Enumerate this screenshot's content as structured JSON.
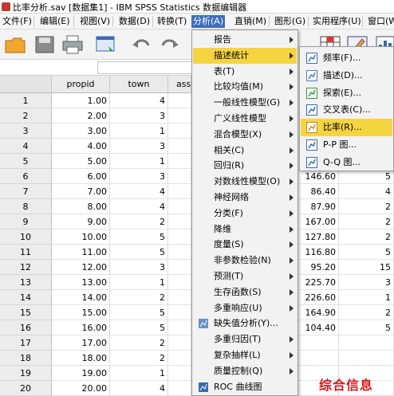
{
  "window": {
    "title": "比率分析.sav [数据集1] - IBM SPSS Statistics 数据编辑器"
  },
  "menubar": [
    {
      "label": "文件(F)"
    },
    {
      "label": "编辑(E)"
    },
    {
      "label": "视图(V)"
    },
    {
      "label": "数据(D)"
    },
    {
      "label": "转换(T)"
    },
    {
      "label": "分析(A)"
    },
    {
      "label": "直销(M)"
    },
    {
      "label": "图形(G)"
    },
    {
      "label": "实用程序(U)"
    },
    {
      "label": "窗口(W)"
    }
  ],
  "columns": [
    "propid",
    "town",
    "ass"
  ],
  "rows": [
    {
      "n": "1",
      "propid": "1.00",
      "town": "4"
    },
    {
      "n": "2",
      "propid": "2.00",
      "town": "3"
    },
    {
      "n": "3",
      "propid": "3.00",
      "town": "1"
    },
    {
      "n": "4",
      "propid": "4.00",
      "town": "3"
    },
    {
      "n": "5",
      "propid": "5.00",
      "town": "1"
    },
    {
      "n": "6",
      "propid": "6.00",
      "town": "3"
    },
    {
      "n": "7",
      "propid": "7.00",
      "town": "4"
    },
    {
      "n": "8",
      "propid": "8.00",
      "town": "4"
    },
    {
      "n": "9",
      "propid": "9.00",
      "town": "2"
    },
    {
      "n": "10",
      "propid": "10.00",
      "town": "5"
    },
    {
      "n": "11",
      "propid": "11.00",
      "town": "5"
    },
    {
      "n": "12",
      "propid": "12.00",
      "town": "3"
    },
    {
      "n": "13",
      "propid": "13.00",
      "town": "1"
    },
    {
      "n": "14",
      "propid": "14.00",
      "town": "2"
    },
    {
      "n": "15",
      "propid": "15.00",
      "town": "5"
    },
    {
      "n": "16",
      "propid": "16.00",
      "town": "5"
    },
    {
      "n": "17",
      "propid": "17.00",
      "town": "2"
    },
    {
      "n": "18",
      "propid": "18.00",
      "town": "2"
    },
    {
      "n": "19",
      "propid": "19.00",
      "town": "1"
    },
    {
      "n": "20",
      "propid": "20.00",
      "town": "4"
    }
  ],
  "right_values": [
    {
      "a": "146.60",
      "b": "5"
    },
    {
      "a": "86.40",
      "b": "4"
    },
    {
      "a": "87.90",
      "b": "2"
    },
    {
      "a": "167.00",
      "b": "2"
    },
    {
      "a": "127.80",
      "b": "2"
    },
    {
      "a": "116.80",
      "b": "5"
    },
    {
      "a": "95.20",
      "b": "15"
    },
    {
      "a": "225.70",
      "b": "3"
    },
    {
      "a": "226.60",
      "b": "1"
    },
    {
      "a": "164.90",
      "b": "2"
    },
    {
      "a": "104.40",
      "b": "5"
    }
  ],
  "analyze_menu": [
    {
      "label": "报告",
      "arrow": true
    },
    {
      "label": "描述统计",
      "arrow": true
    },
    {
      "label": "表(T)",
      "arrow": true
    },
    {
      "label": "比较均值(M)",
      "arrow": true
    },
    {
      "label": "一般线性模型(G)",
      "arrow": true
    },
    {
      "label": "广义线性模型",
      "arrow": true
    },
    {
      "label": "混合模型(X)",
      "arrow": true
    },
    {
      "label": "相关(C)",
      "arrow": true
    },
    {
      "label": "回归(R)",
      "arrow": true
    },
    {
      "label": "对数线性模型(O)",
      "arrow": true
    },
    {
      "label": "神经网络",
      "arrow": true
    },
    {
      "label": "分类(F)",
      "arrow": true
    },
    {
      "label": "降维",
      "arrow": true
    },
    {
      "label": "度量(S)",
      "arrow": true
    },
    {
      "label": "非参数检验(N)",
      "arrow": true
    },
    {
      "label": "预测(T)",
      "arrow": true
    },
    {
      "label": "生存函数(S)",
      "arrow": true
    },
    {
      "label": "多重响应(U)",
      "arrow": true
    },
    {
      "label": "缺失值分析(Y)...",
      "arrow": false,
      "icon": "missing-value-icon"
    },
    {
      "label": "多重归因(T)",
      "arrow": true
    },
    {
      "label": "复杂抽样(L)",
      "arrow": true
    },
    {
      "label": "质量控制(Q)",
      "arrow": true
    },
    {
      "label": "ROC 曲线图",
      "arrow": false,
      "icon": "roc-curve-icon"
    }
  ],
  "descriptive_submenu": [
    {
      "label": "频率(F)...",
      "icon": "frequencies-icon"
    },
    {
      "label": "描述(D)...",
      "icon": "descriptives-icon"
    },
    {
      "label": "探索(E)...",
      "icon": "explore-icon"
    },
    {
      "label": "交叉表(C)...",
      "icon": "crosstabs-icon"
    },
    {
      "label": "比率(R)...",
      "icon": "ratio-icon"
    },
    {
      "label": "P-P 图...",
      "icon": "pp-plot-icon"
    },
    {
      "label": "Q-Q 图...",
      "icon": "qq-plot-icon"
    }
  ],
  "watermark": "综合信息",
  "colors": {
    "menu_highlight": "#f5d442",
    "active_menu": "#3d6fb8",
    "watermark": "#d01818"
  }
}
